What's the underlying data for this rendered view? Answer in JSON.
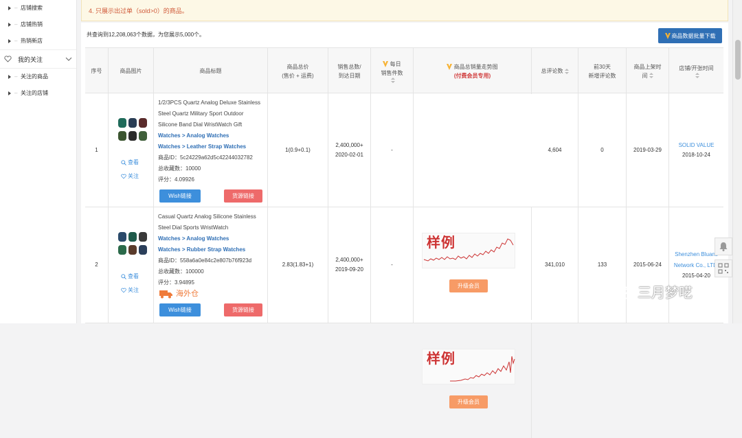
{
  "sidebar": {
    "top_items": [
      {
        "label": "店铺搜索"
      },
      {
        "label": "店铺热销"
      },
      {
        "label": "热销新店"
      }
    ],
    "group": {
      "label": "我的关注"
    },
    "group_items": [
      {
        "label": "关注的商品"
      },
      {
        "label": "关注的店铺"
      }
    ]
  },
  "notice": "4. 只展示出过单（sold>0）的商品。",
  "summary": "共查询到12,208,063个数据，为您展示5,000个。",
  "download_label": "商品数据批量下载",
  "columns": {
    "index": "序号",
    "image": "商品图片",
    "title": "商品标题",
    "price_l1": "商品总价",
    "price_l2": "(售价 + 运费)",
    "sold_l1": "销售总数/",
    "sold_l2": "到达日期",
    "daily_l1": "每日",
    "daily_l2": "销售件数",
    "trend_l1": "商品总销量走势图",
    "trend_l2": "(付费会员专用)",
    "reviews": "总评论数",
    "new_reviews_l1": "前30天",
    "new_reviews_l2": "新增评论数",
    "listed_l1": "商品上架时",
    "listed_l2": "间",
    "shop": "店铺/开张时间"
  },
  "chart_watermark": "样例",
  "upgrade_label": "升级会员",
  "view_label": "查看",
  "follow_label": "关注",
  "wish_label": "Wish链接",
  "source_label": "货源链接",
  "warehouse_label": "海外仓",
  "rows": [
    {
      "index": "1",
      "title": "1/2/3PCS Quartz Analog Deluxe Stainless Steel Quartz Military Sport Outdoor Silicone Band Dial WristWatch Gift",
      "cat1": "Watches > Analog Watches",
      "cat2": "Watches > Leather Strap Watches",
      "id": "商品ID：5c24229a62d5c42244032782",
      "fav": "总收藏数：10000",
      "score": "评分：4.09926",
      "price": "1(0.9+0.1)",
      "sold": "2,400,000+",
      "arrive": "2020-02-01",
      "daily": "-",
      "reviews": "4,604",
      "new_reviews": "0",
      "listed": "2019-03-29",
      "shop": "SOLID VALUE",
      "shop_date": "2018-10-24"
    },
    {
      "index": "2",
      "title": "Casual Quartz Analog Silicone Stainless Steel Dial Sports WristWatch",
      "cat1": "Watches > Analog Watches",
      "cat2": "Watches > Rubber Strap Watches",
      "id": "商品ID：558a6a0e84c2e807b76f923d",
      "fav": "总收藏数：100000",
      "score": "评分：3.94895",
      "price": "2.83(1.83+1)",
      "sold": "2,400,000+",
      "arrive": "2019-09-20",
      "daily": "-",
      "reviews": "341,010",
      "new_reviews": "133",
      "listed": "2015-06-24",
      "shop": "Shenzhen Bluans Network Co., LTD.",
      "shop_date": "2015-04-20"
    }
  ],
  "overlay_text": "三月梦呓",
  "colors": {
    "accent": "#2f6fb5",
    "wish": "#3d8fdc",
    "source": "#ee6a6a",
    "upgrade": "#f79b66",
    "notice_text": "#d05a3a"
  }
}
